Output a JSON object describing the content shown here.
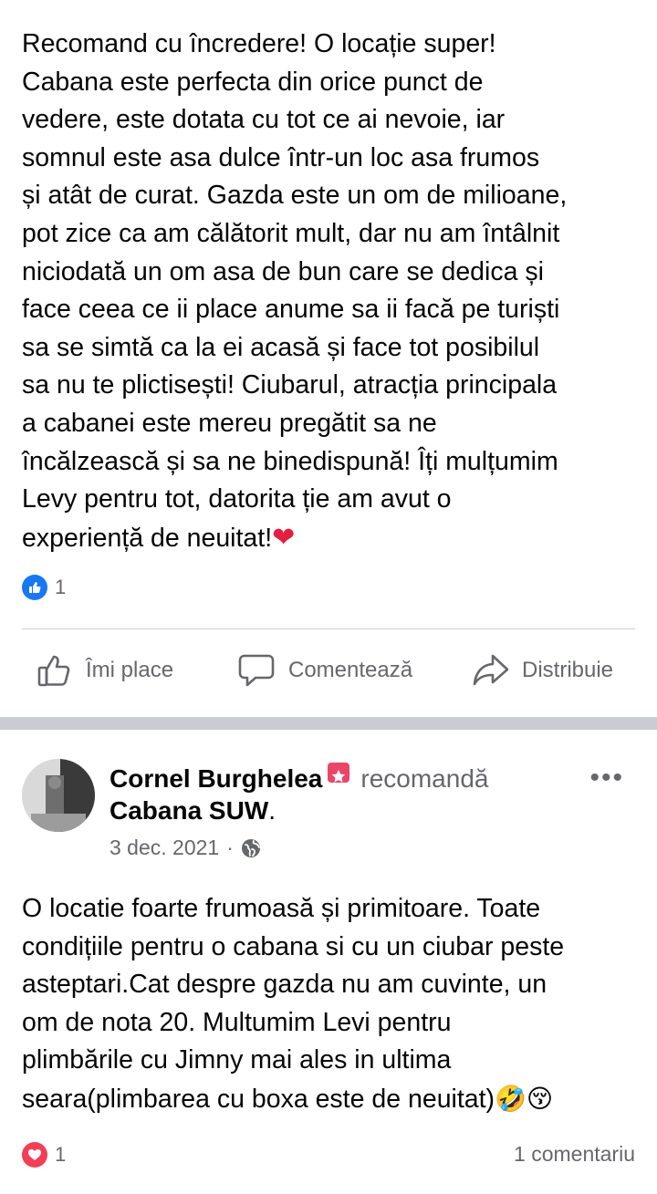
{
  "post1": {
    "text": "Recomand cu încredere! O locație super!\nCabana este perfecta din orice punct de\nvedere, este dotata cu tot ce ai nevoie, iar\nsomnul este asa dulce într-un loc asa frumos\nși atât de curat. Gazda este un om de milioane,\npot zice ca am călătorit mult, dar nu am întâlnit\nniciodată un om asa de bun care se dedica și\nface ceea ce ii place anume sa ii facă pe turiști\nsa se simtă ca la ei acasă și face tot posibilul\nsa nu te plictisești! Ciubarul, atracția principala\na cabanei este mereu pregătit sa ne\nîncălzească și sa ne binedispună! Îți mulțumim\nLevy pentru tot, datorita ție am avut o\nexperiență de neuitat!",
    "trailing_emoji": "❤",
    "reaction_icon": "like-icon",
    "reaction_count": "1"
  },
  "actions": {
    "like_label": "Îmi place",
    "comment_label": "Comentează",
    "share_label": "Distribuie"
  },
  "post2": {
    "author": "Cornel Burghelea",
    "recommends_text": "recomandă",
    "page_name": "Cabana SUW",
    "page_suffix": ".",
    "date": "3 dec. 2021",
    "date_separator": "·",
    "privacy_icon": "globe-icon",
    "more_icon": "•••",
    "text": "O locatie foarte frumoasă și primitoare. Toate\ncondițiile pentru o cabana si cu un ciubar peste\nasteptari.Cat despre gazda nu am cuvinte, un\nom de nota 20. Multumim Levi pentru\nplimbările cu Jimny mai ales in ultima\nseara(plimbarea cu boxa este de neuitat)",
    "trailing_emojis": "🤣😚",
    "reaction_icon": "love-icon",
    "reaction_count": "1",
    "comments_count": "1 comentariu"
  },
  "colors": {
    "text": "#050505",
    "secondary": "#65676b",
    "like_blue": "#1877f2",
    "love_red": "#f33e58",
    "divider": "#ced0d4",
    "separator": "#c9ccd1"
  }
}
